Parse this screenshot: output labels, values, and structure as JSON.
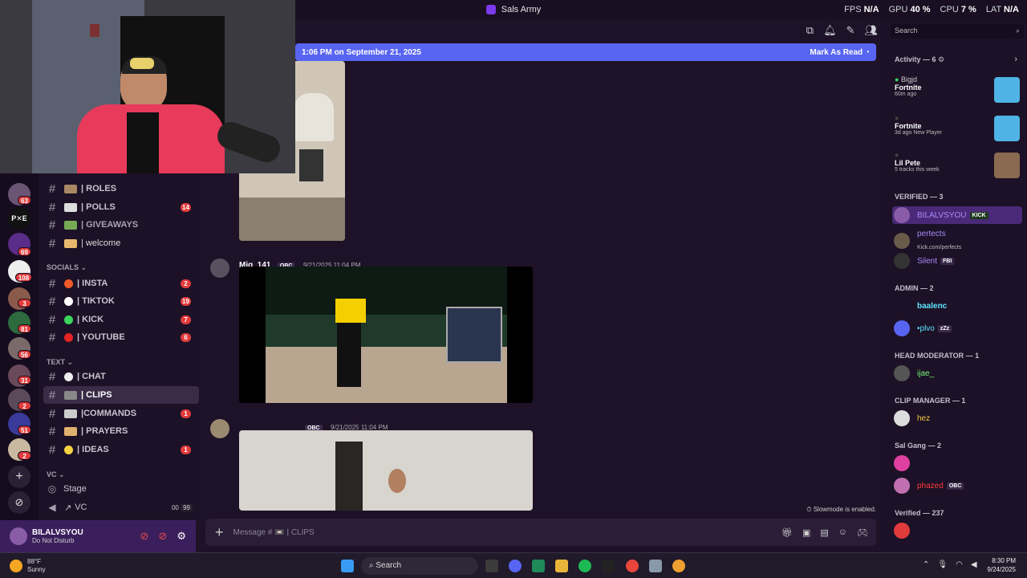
{
  "window": {
    "title": "Sals Army"
  },
  "perf": {
    "fps_label": "FPS",
    "fps": "N/A",
    "gpu_label": "GPU",
    "gpu": "40 %",
    "cpu_label": "CPU",
    "cpu": "7 %",
    "lat_label": "LAT",
    "lat": "N/A"
  },
  "rail": {
    "badges": [
      "63",
      "69",
      "108",
      "3",
      "81",
      "56",
      "31",
      "2",
      "51",
      "2"
    ]
  },
  "channels": {
    "top": [
      {
        "label": "| ROLES",
        "count": ""
      },
      {
        "label": "| POLLS",
        "count": "14"
      },
      {
        "label": "| GIVEAWAYS",
        "count": ""
      },
      {
        "label": "| welcome",
        "count": ""
      }
    ],
    "socials_label": "SOCIALS",
    "socials": [
      {
        "label": "| INSTA",
        "count": "2"
      },
      {
        "label": "| TIKTOK",
        "count": "19"
      },
      {
        "label": "| KICK",
        "count": "7"
      },
      {
        "label": "| YOUTUBE",
        "count": "6"
      }
    ],
    "text_label": "TEXT",
    "text": [
      {
        "label": "| CHAT",
        "count": ""
      },
      {
        "label": "| CLIPS",
        "count": ""
      },
      {
        "label": "|COMMANDS",
        "count": "1"
      },
      {
        "label": "| PRAYERS",
        "count": ""
      },
      {
        "label": "| IDEAS",
        "count": "1"
      }
    ],
    "vc_label": "VC",
    "voice": [
      {
        "label": "Stage"
      },
      {
        "label": "VC",
        "meta1": "00",
        "meta2": "99"
      }
    ]
  },
  "user": {
    "name": "BILALVSYOU",
    "status": "Do Not Disturb"
  },
  "banner": {
    "text": "1:06 PM on September 21, 2025",
    "action": "Mark As Read"
  },
  "messages": [
    {
      "author": "Mig_141",
      "tag": "OBC",
      "time": "9/21/2025 11:04 PM"
    },
    {
      "author": "",
      "tag": "OBC",
      "time": "9/21/2025 11:04 PM"
    }
  ],
  "composer": {
    "placeholder": "Message # 📼 | CLIPS"
  },
  "slowmode": "Slowmode is enabled.",
  "members": {
    "search_placeholder": "Search",
    "activity_header": "Activity — 6",
    "activities": [
      {
        "user": "Bigjd",
        "game": "Fortnite",
        "meta": "60m ago"
      },
      {
        "user": "",
        "game": "Fortnite",
        "meta": "3d ago  New Player"
      },
      {
        "user": "",
        "game": "Lil Pete",
        "meta": "5 tracks this week"
      }
    ],
    "groups": [
      {
        "header": "VERIFIED — 3",
        "rows": [
          {
            "name": "BILALVSYOU",
            "badge": "KICK",
            "color": "#a78bfa"
          },
          {
            "name": "pertects",
            "sub": "Kick.com/perfects",
            "color": "#a78bfa"
          },
          {
            "name": "Silent",
            "badge": "FBI",
            "color": "#a78bfa"
          }
        ]
      },
      {
        "header": "ADMIN — 2",
        "rows": [
          {
            "name": "baalenc",
            "color": "#5ee3ff"
          },
          {
            "name": "•plvo",
            "badge": "zZz",
            "color": "#5ee3ff"
          }
        ]
      },
      {
        "header": "HEAD MODERATOR — 1",
        "rows": [
          {
            "name": "ijae_",
            "color": "#7cf57c"
          }
        ]
      },
      {
        "header": "CLIP MANAGER — 1",
        "rows": [
          {
            "name": "hez",
            "color": "#f5c842"
          }
        ]
      },
      {
        "header": "Sal Gang — 2",
        "rows": [
          {
            "name": "",
            "color": "#ff3b3b"
          },
          {
            "name": "phazed",
            "badge": "OBC",
            "color": "#ff3b3b"
          }
        ]
      },
      {
        "header": "Verified — 237",
        "rows": [
          {
            "name": "",
            "color": "#ddd"
          }
        ]
      }
    ]
  },
  "taskbar": {
    "weather_temp": "88°F",
    "weather_desc": "Sunny",
    "search_label": "Search",
    "time": "8:30 PM",
    "date": "9/24/2025"
  },
  "colors": {
    "accent": "#5865f2",
    "bg": "#1e1228",
    "sidebar": "#1c1126",
    "dnd": "#e23b3b"
  }
}
